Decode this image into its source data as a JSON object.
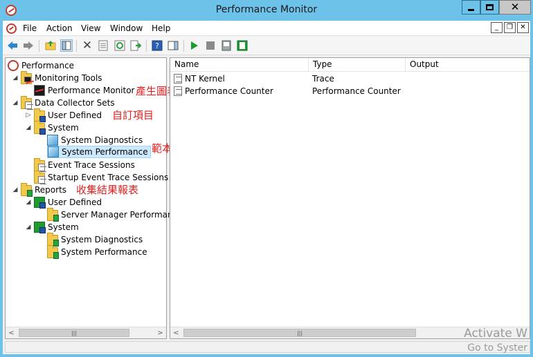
{
  "window": {
    "title": "Performance Monitor"
  },
  "menu": {
    "items": [
      "File",
      "Action",
      "View",
      "Window",
      "Help"
    ]
  },
  "tree": {
    "items": [
      {
        "label": "Performance"
      },
      {
        "label": "Monitoring Tools"
      },
      {
        "label": "Performance Monitor"
      },
      {
        "label": "Data Collector Sets"
      },
      {
        "label": "User Defined"
      },
      {
        "label": "System"
      },
      {
        "label": "System Diagnostics"
      },
      {
        "label": "System Performance"
      },
      {
        "label": "Event Trace Sessions"
      },
      {
        "label": "Startup Event Trace Sessions"
      },
      {
        "label": "Reports"
      },
      {
        "label": "User Defined"
      },
      {
        "label": "Server Manager Performanc"
      },
      {
        "label": "System"
      },
      {
        "label": "System Diagnostics"
      },
      {
        "label": "System Performance"
      }
    ]
  },
  "annotations": [
    "產生圖表",
    "自訂項目",
    "範本",
    "收集結果報表"
  ],
  "list": {
    "columns": [
      "Name",
      "Type",
      "Output"
    ],
    "rows": [
      {
        "name": "NT Kernel",
        "type": "Trace",
        "output": ""
      },
      {
        "name": "Performance Counter",
        "type": "Performance Counter",
        "output": ""
      }
    ]
  },
  "watermark": {
    "line1": "Activate W",
    "line2": "Go to Syster"
  },
  "colors": {
    "titlebar": "#6dc2e9",
    "annotation": "#e02020",
    "selection": "#cce8ff"
  }
}
